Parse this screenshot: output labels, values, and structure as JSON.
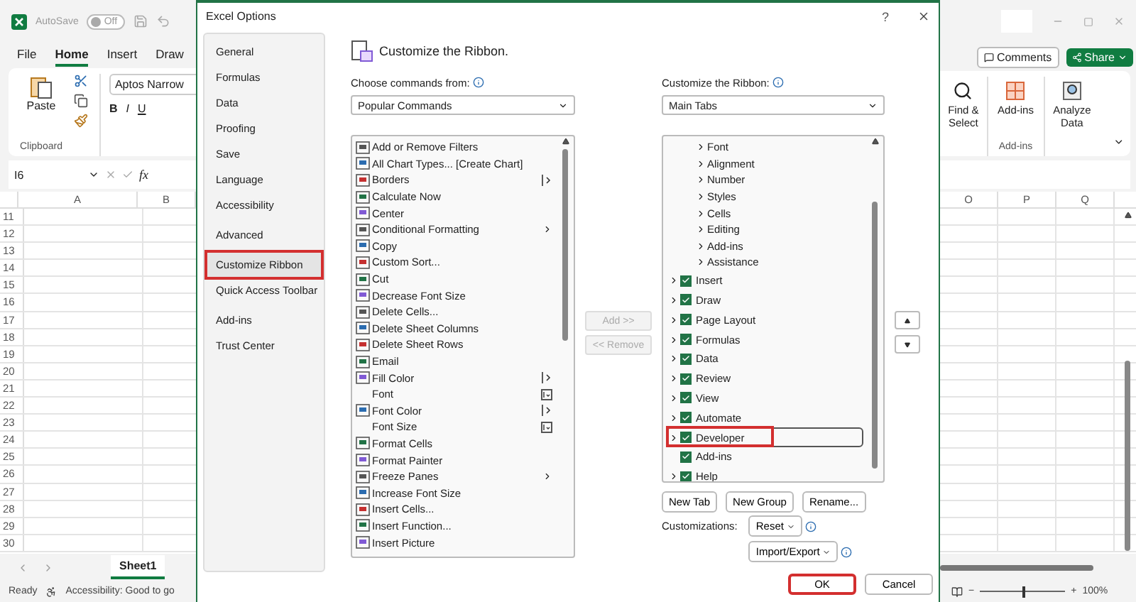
{
  "excel": {
    "autosave": {
      "label": "AutoSave",
      "on": false,
      "state_text": "Off"
    },
    "ribbon_tabs": [
      {
        "label": "File",
        "selected": false
      },
      {
        "label": "Home",
        "selected": true
      },
      {
        "label": "Insert",
        "selected": false
      },
      {
        "label": "Draw",
        "selected": false
      }
    ],
    "paste_label": "Paste",
    "clipboard_group": "Clipboard",
    "font_name": "Aptos Narrow",
    "format_buttons": [
      "B",
      "I",
      "U"
    ],
    "name_box": "I6",
    "function_label": "fx",
    "left_columns": [
      "A",
      "B"
    ],
    "rows": [
      "11",
      "12",
      "13",
      "14",
      "15",
      "16",
      "17",
      "18",
      "19",
      "20",
      "21",
      "22",
      "23",
      "24",
      "25",
      "26",
      "27",
      "28",
      "29",
      "30"
    ],
    "sheet_tab": "Sheet1",
    "status": "Ready",
    "accessibility": "Accessibility: Good to go",
    "comments": "Comments",
    "share": "Share",
    "find_select": "Find & Select",
    "add_ins": "Add-ins",
    "analyze_data": "Analyze Data",
    "add_ins_group": "Add-ins",
    "right_columns": [
      "O",
      "P",
      "Q"
    ],
    "zoom": {
      "level": 0.5,
      "reading": "100%",
      "zoom_out": "−",
      "zoom_in": "+"
    }
  },
  "dialog": {
    "title": "Excel Options",
    "help": "?",
    "nav": [
      {
        "label": "General",
        "selected": false,
        "highlighted": false
      },
      {
        "label": "Formulas",
        "selected": false,
        "highlighted": false
      },
      {
        "label": "Data",
        "selected": false,
        "highlighted": false
      },
      {
        "label": "Proofing",
        "selected": false,
        "highlighted": false
      },
      {
        "label": "Save",
        "selected": false,
        "highlighted": false
      },
      {
        "label": "Language",
        "selected": false,
        "highlighted": false
      },
      {
        "label": "Accessibility",
        "selected": false,
        "highlighted": false
      },
      {
        "label": "Advanced",
        "selected": false,
        "highlighted": false
      },
      {
        "label": "Customize Ribbon",
        "selected": true,
        "highlighted": true
      },
      {
        "label": "Quick Access Toolbar",
        "selected": false,
        "highlighted": false
      },
      {
        "label": "Add-ins",
        "selected": false,
        "highlighted": false
      },
      {
        "label": "Trust Center",
        "selected": false,
        "highlighted": false
      }
    ],
    "heading": "Customize the Ribbon.",
    "commands_label": "Choose commands from:",
    "commands_source": "Popular Commands",
    "commands": [
      {
        "label": "Add or Remove Filters",
        "kind": "button"
      },
      {
        "label": "All Chart Types... [Create Chart]",
        "kind": "button"
      },
      {
        "label": "Borders",
        "kind": "split"
      },
      {
        "label": "Calculate Now",
        "kind": "button"
      },
      {
        "label": "Center",
        "kind": "button"
      },
      {
        "label": "Conditional Formatting",
        "kind": "menu"
      },
      {
        "label": "Copy",
        "kind": "button"
      },
      {
        "label": "Custom Sort...",
        "kind": "button"
      },
      {
        "label": "Cut",
        "kind": "button"
      },
      {
        "label": "Decrease Font Size",
        "kind": "button"
      },
      {
        "label": "Delete Cells...",
        "kind": "button"
      },
      {
        "label": "Delete Sheet Columns",
        "kind": "button"
      },
      {
        "label": "Delete Sheet Rows",
        "kind": "button"
      },
      {
        "label": "Email",
        "kind": "button"
      },
      {
        "label": "Fill Color",
        "kind": "split"
      },
      {
        "label": "Font",
        "kind": "field"
      },
      {
        "label": "Font Color",
        "kind": "split"
      },
      {
        "label": "Font Size",
        "kind": "field"
      },
      {
        "label": "Format Cells",
        "kind": "button"
      },
      {
        "label": "Format Painter",
        "kind": "button"
      },
      {
        "label": "Freeze Panes",
        "kind": "menu"
      },
      {
        "label": "Increase Font Size",
        "kind": "button"
      },
      {
        "label": "Insert Cells...",
        "kind": "button"
      },
      {
        "label": "Insert Function...",
        "kind": "button"
      },
      {
        "label": "Insert Picture",
        "kind": "button"
      }
    ],
    "transfer_buttons": [
      {
        "label": "Add >>",
        "disabled": true
      },
      {
        "label": "<< Remove",
        "disabled": true
      }
    ],
    "ribbon_label": "Customize the Ribbon:",
    "ribbon_source": "Main Tabs",
    "home_groups": [
      "Font",
      "Alignment",
      "Number",
      "Styles",
      "Cells",
      "Editing",
      "Add-ins",
      "Assistance"
    ],
    "tabs": [
      {
        "label": "Insert",
        "checked": true,
        "expandable": true,
        "selected": false,
        "highlighted": false
      },
      {
        "label": "Draw",
        "checked": true,
        "expandable": true,
        "selected": false,
        "highlighted": false
      },
      {
        "label": "Page Layout",
        "checked": true,
        "expandable": true,
        "selected": false,
        "highlighted": false
      },
      {
        "label": "Formulas",
        "checked": true,
        "expandable": true,
        "selected": false,
        "highlighted": false
      },
      {
        "label": "Data",
        "checked": true,
        "expandable": true,
        "selected": false,
        "highlighted": false
      },
      {
        "label": "Review",
        "checked": true,
        "expandable": true,
        "selected": false,
        "highlighted": false
      },
      {
        "label": "View",
        "checked": true,
        "expandable": true,
        "selected": false,
        "highlighted": false
      },
      {
        "label": "Automate",
        "checked": true,
        "expandable": true,
        "selected": false,
        "highlighted": false
      },
      {
        "label": "Developer",
        "checked": true,
        "expandable": true,
        "selected": true,
        "highlighted": true
      },
      {
        "label": "Add-ins",
        "checked": true,
        "expandable": false,
        "selected": false,
        "highlighted": false
      },
      {
        "label": "Help",
        "checked": true,
        "expandable": true,
        "selected": false,
        "highlighted": false
      }
    ],
    "tab_buttons": [
      "New Tab",
      "New Group",
      "Rename..."
    ],
    "customizations_label": "Customizations:",
    "reset": "Reset",
    "import_export": "Import/Export",
    "ok": {
      "label": "OK",
      "highlighted": true
    },
    "cancel": "Cancel"
  }
}
